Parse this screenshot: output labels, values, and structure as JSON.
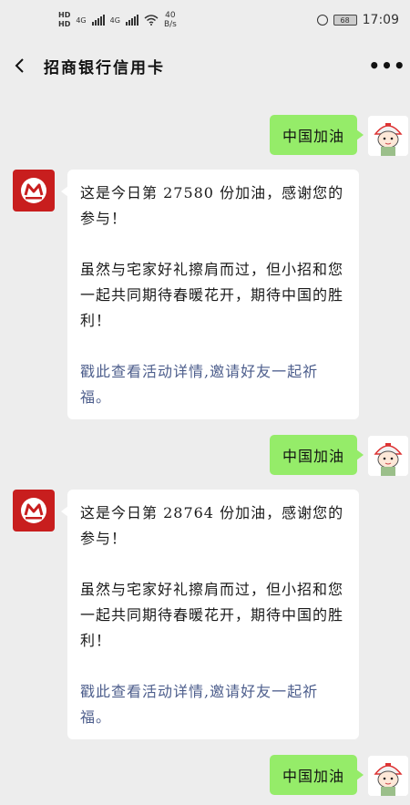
{
  "status_bar": {
    "hd1": "HD",
    "hd2": "HD",
    "net1": "4G",
    "net2": "4G",
    "speed_value": "40",
    "speed_unit": "B/s",
    "battery": "68",
    "time": "17:09"
  },
  "header": {
    "title": "招商银行信用卡"
  },
  "messages": [
    {
      "type": "outgoing",
      "text": "中国加油"
    },
    {
      "type": "incoming",
      "line1": "这是今日第 27580 份加油，感谢您的参与！",
      "line2": "虽然与宅家好礼擦肩而过，但小招和您一起共同期待春暖花开，期待中国的胜利！",
      "link": "戳此查看活动详情,邀请好友一起祈福。"
    },
    {
      "type": "outgoing",
      "text": "中国加油"
    },
    {
      "type": "incoming",
      "line1": "这是今日第 28764 份加油，感谢您的参与！",
      "line2": "虽然与宅家好礼擦肩而过，但小招和您一起共同期待春暖花开，期待中国的胜利！",
      "link": "戳此查看活动详情,邀请好友一起祈福。"
    },
    {
      "type": "outgoing",
      "text": "中国加油"
    }
  ],
  "icons": [
    "back-icon",
    "more-icon",
    "wifi-icon",
    "alarm-icon",
    "battery-icon",
    "bank-logo",
    "user-avatar"
  ],
  "colors": {
    "background": "#ededed",
    "outgoing_bubble": "#95ec69",
    "incoming_bubble": "#ffffff",
    "link": "#4d5e8c",
    "bank_red": "#c81e1e"
  }
}
